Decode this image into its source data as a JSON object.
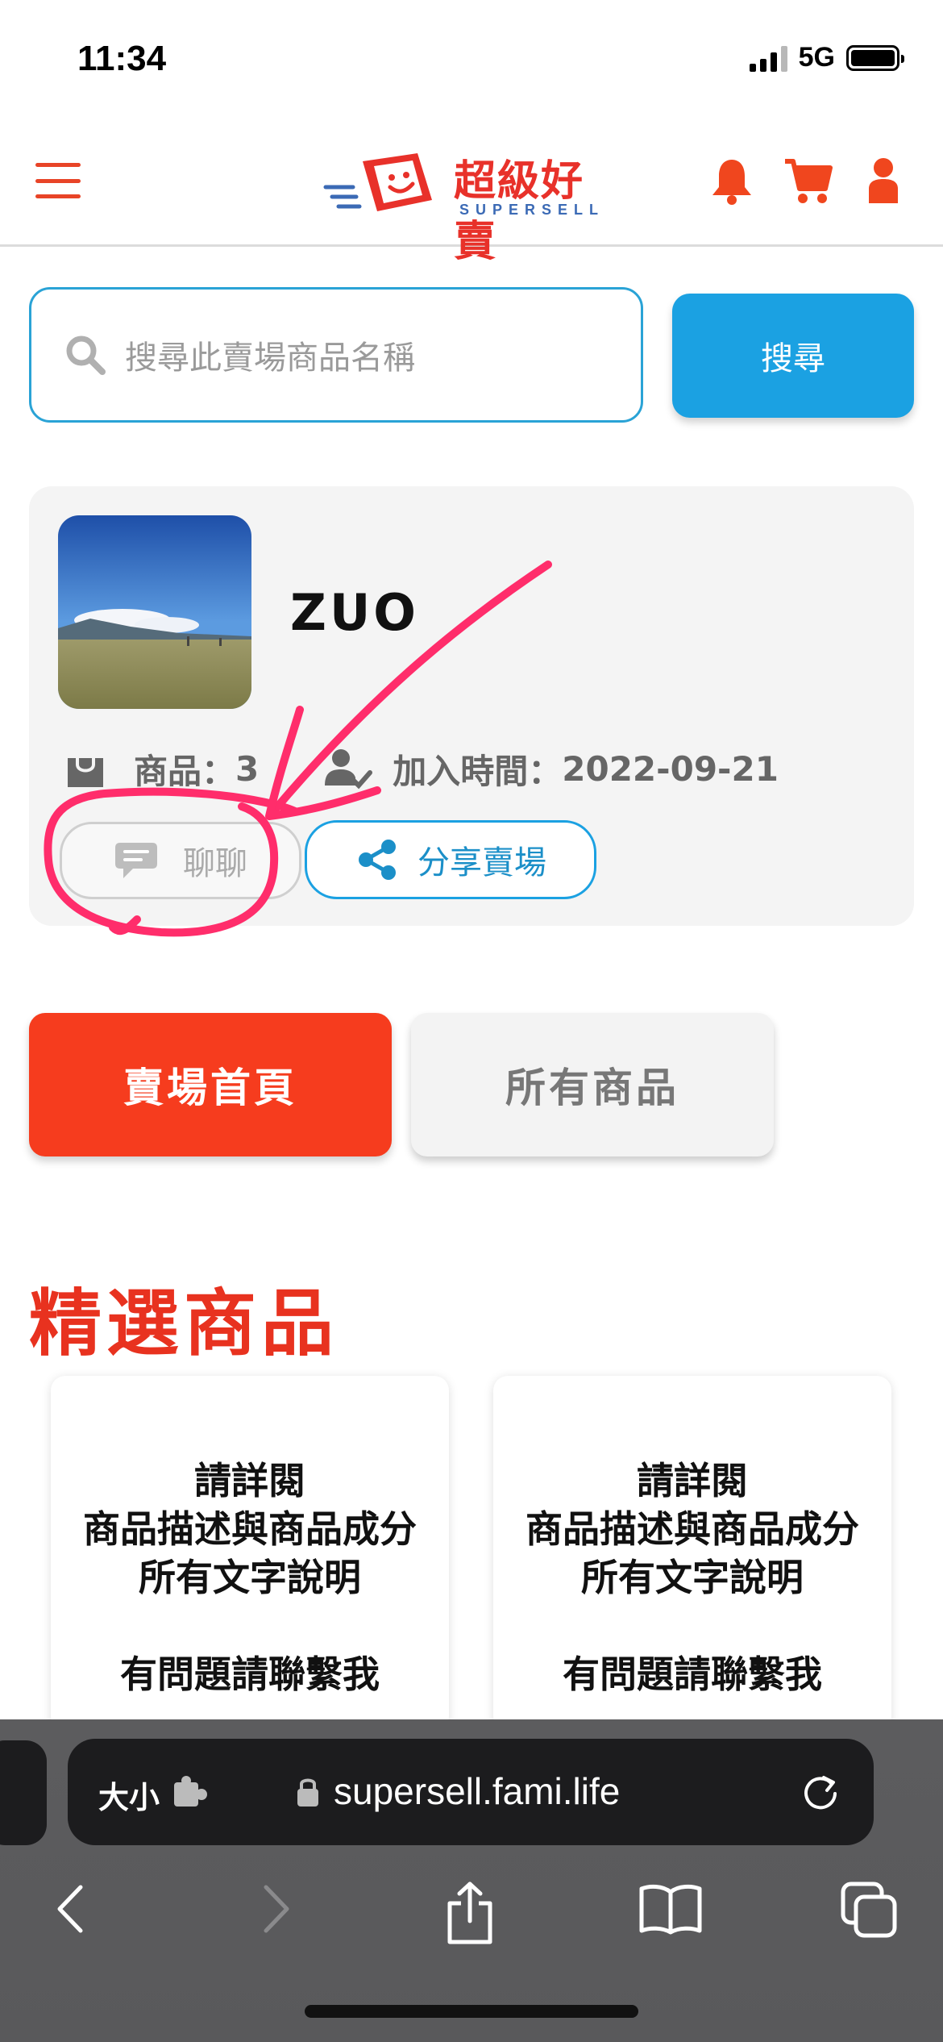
{
  "status_bar": {
    "time": "11:34",
    "network": "5G"
  },
  "header": {
    "logo_text": "超級好賣",
    "logo_subtext": "SUPERSELL"
  },
  "search": {
    "placeholder": "搜尋此賣場商品名稱",
    "button_label": "搜尋"
  },
  "shop": {
    "name": "ZUO",
    "products_label": "商品：",
    "products_count": "3",
    "joined_label": "加入時間：",
    "joined_date": "2022-09-21",
    "chat_label": "聊聊",
    "share_label": "分享賣場"
  },
  "tabs": {
    "home_label": "賣場首頁",
    "all_label": "所有商品"
  },
  "featured": {
    "title": "精選商品",
    "cards": [
      {
        "line1": "請詳閱",
        "line2": "商品描述與商品成分",
        "line3": "所有文字說明",
        "line4": "有問題請聯繫我"
      },
      {
        "line1": "請詳閱",
        "line2": "商品描述與商品成分",
        "line3": "所有文字說明",
        "line4": "有問題請聯繫我"
      }
    ]
  },
  "browser": {
    "size_label": "大小",
    "url": "supersell.fami.life"
  },
  "colors": {
    "brand_red": "#f63c1e",
    "accent_blue": "#1ba1e2",
    "annotation_pink": "#ff2d6b"
  },
  "icons": [
    "menu-icon",
    "bell-icon",
    "cart-icon",
    "user-icon",
    "search-icon",
    "bag-icon",
    "user-check-icon",
    "chat-icon",
    "share-icon",
    "lock-icon",
    "reload-icon",
    "back-icon",
    "forward-icon",
    "share-sheet-icon",
    "bookmarks-icon",
    "tabs-icon"
  ]
}
